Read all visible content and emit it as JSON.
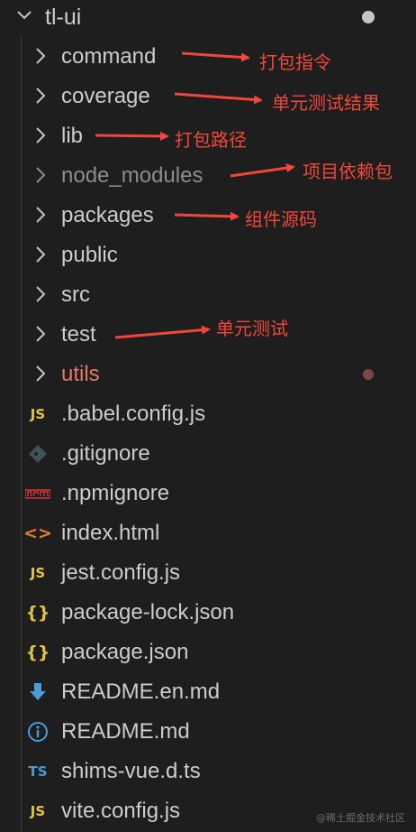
{
  "root": {
    "label": "tl-ui"
  },
  "items": [
    {
      "label": "command",
      "icon": "chevron-right-icon"
    },
    {
      "label": "coverage",
      "icon": "chevron-right-icon"
    },
    {
      "label": "lib",
      "icon": "chevron-right-icon"
    },
    {
      "label": "node_modules",
      "icon": "chevron-right-icon"
    },
    {
      "label": "packages",
      "icon": "chevron-right-icon"
    },
    {
      "label": "public",
      "icon": "chevron-right-icon"
    },
    {
      "label": "src",
      "icon": "chevron-right-icon"
    },
    {
      "label": "test",
      "icon": "chevron-right-icon"
    },
    {
      "label": "utils",
      "icon": "chevron-right-icon"
    },
    {
      "label": ".babel.config.js",
      "icon": "js-file-icon",
      "icon_text": "JS"
    },
    {
      "label": ".gitignore",
      "icon": "git-icon"
    },
    {
      "label": ".npmignore",
      "icon": "npm-icon"
    },
    {
      "label": "index.html",
      "icon": "html-icon",
      "icon_text": "<>"
    },
    {
      "label": "jest.config.js",
      "icon": "js-file-icon",
      "icon_text": "JS"
    },
    {
      "label": "package-lock.json",
      "icon": "json-icon",
      "icon_text": "{}"
    },
    {
      "label": "package.json",
      "icon": "json-icon",
      "icon_text": "{}"
    },
    {
      "label": "README.en.md",
      "icon": "download-arrow-icon"
    },
    {
      "label": "README.md",
      "icon": "info-icon"
    },
    {
      "label": "shims-vue.d.ts",
      "icon": "ts-file-icon",
      "icon_text": "TS"
    },
    {
      "label": "vite.config.js",
      "icon": "js-file-icon",
      "icon_text": "JS"
    }
  ],
  "annotations": [
    {
      "text": "打包指令"
    },
    {
      "text": "单元测试结果"
    },
    {
      "text": "打包路径"
    },
    {
      "text": "项目依赖包"
    },
    {
      "text": "组件源码"
    },
    {
      "text": "单元测试"
    }
  ],
  "watermark": "@稀土掘金技术社区",
  "colors": {
    "background": "#1e1e1e",
    "text": "#cccccc",
    "ignored_text": "#8c8c8c",
    "error_text": "#e8776b",
    "annotation": "#f0473b"
  }
}
